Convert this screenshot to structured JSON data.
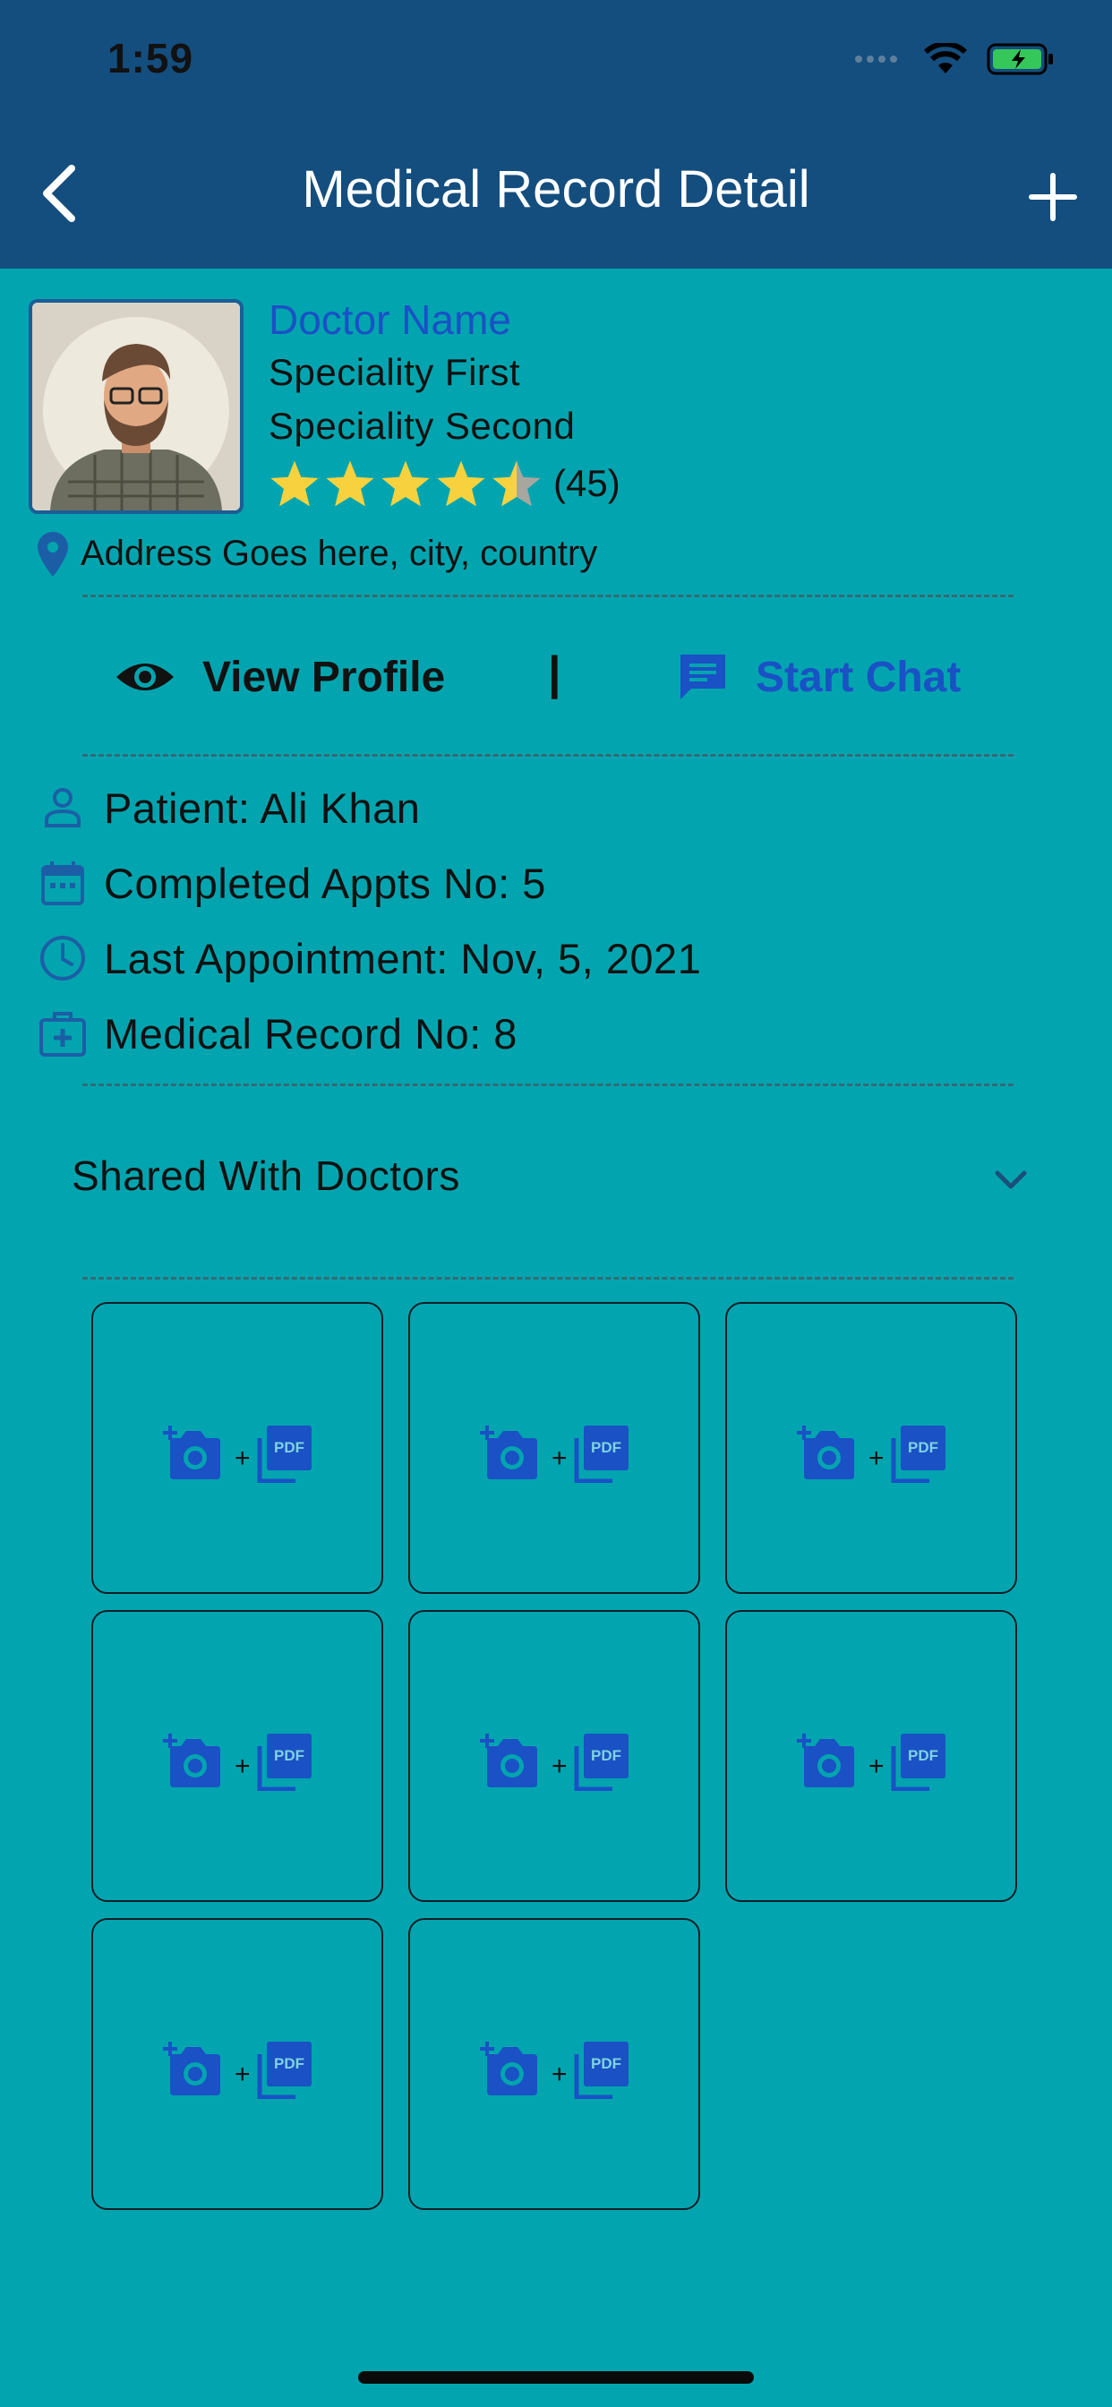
{
  "status_bar": {
    "time": "1:59"
  },
  "nav": {
    "title": "Medical Record Detail"
  },
  "doctor": {
    "name": "Doctor Name",
    "speciality_first": "Speciality First",
    "speciality_second": "Speciality Second",
    "rating": 4.5,
    "rating_max": 5,
    "rating_count": "(45)",
    "address": "Address Goes here, city, country"
  },
  "actions": {
    "view_profile": "View Profile",
    "separator": "|",
    "start_chat": "Start Chat"
  },
  "info": {
    "patient": "Patient: Ali Khan",
    "completed_appts": "Completed Appts No: 5",
    "last_appointment": "Last Appointment: Nov, 5, 2021",
    "medical_record": "Medical Record No: 8"
  },
  "shared": {
    "title": "Shared With Doctors"
  },
  "attachments": {
    "slot_icon": "camera-plus-pdf-icon",
    "slot_count": 8,
    "plus_glyph": "+",
    "pdf_label": "PDF"
  },
  "colors": {
    "background": "#02A5AF",
    "header": "#144E7F",
    "accent_blue": "#1A51C5",
    "star": "#F7D23E"
  },
  "icons": {
    "back": "chevron-left-icon",
    "add": "plus-icon",
    "location": "location-pin-icon",
    "view": "eye-icon",
    "chat": "chat-bubble-icon",
    "patient": "person-icon",
    "appointments": "calendar-icon",
    "last_appointment": "clock-icon",
    "medical_record": "medical-kit-icon",
    "expand": "chevron-down-icon"
  }
}
